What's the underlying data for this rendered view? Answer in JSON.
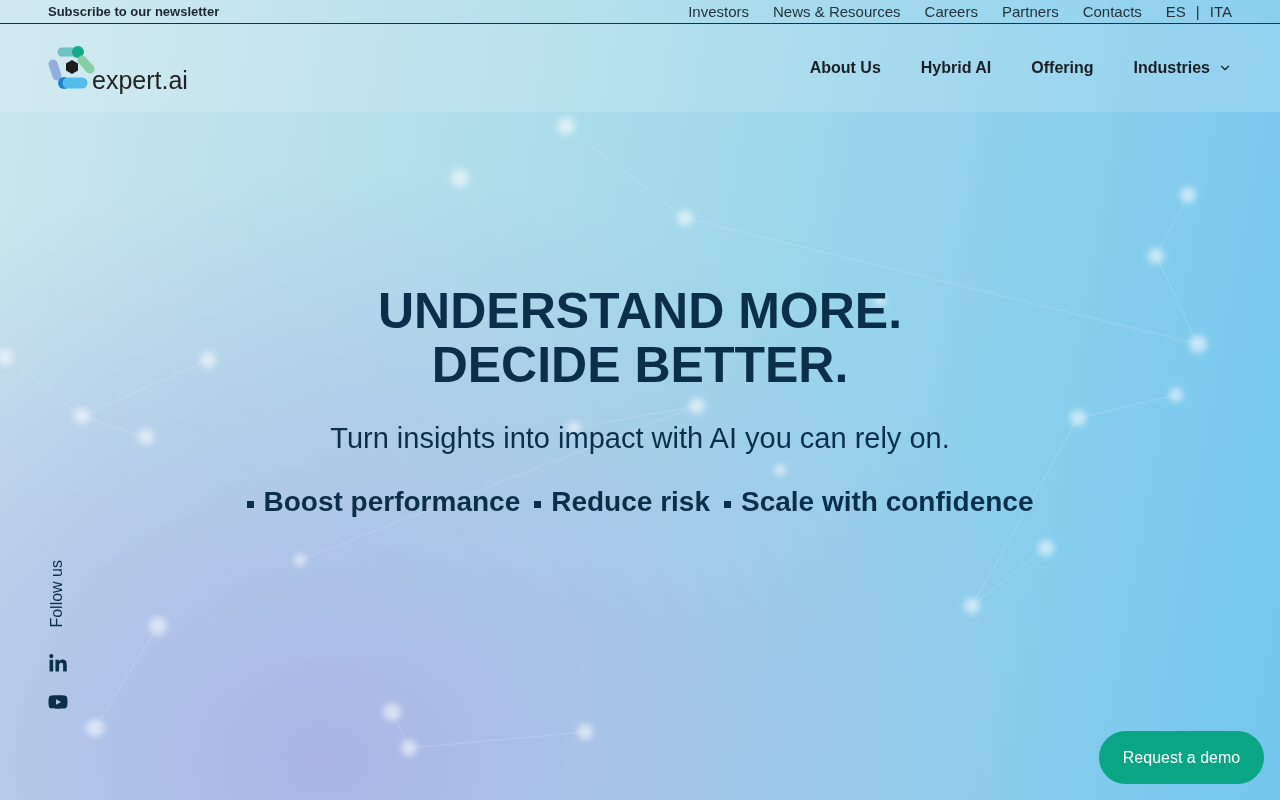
{
  "top_bar": {
    "newsletter_link": "Subscribe to our newsletter",
    "links": [
      "Investors",
      "News & Resources",
      "Careers",
      "Partners",
      "Contacts"
    ],
    "languages": [
      "ES",
      "ITA"
    ],
    "language_separator": "|"
  },
  "header": {
    "logo_text": "expert.ai",
    "nav": [
      {
        "label": "About Us",
        "kind": "link"
      },
      {
        "label": "Hybrid AI",
        "kind": "link"
      },
      {
        "label": "Offering",
        "kind": "link"
      },
      {
        "label": "Industries",
        "kind": "dropdown"
      }
    ]
  },
  "hero": {
    "title_lines": [
      "UNDERSTAND MORE.",
      "DECIDE BETTER."
    ],
    "subtitle": "Turn insights into impact with AI you can rely on.",
    "highlights": [
      "Boost performance",
      "Reduce risk",
      "Scale with confidence"
    ]
  },
  "social": {
    "label": "Follow us",
    "links": [
      {
        "kind": "linkedin"
      },
      {
        "kind": "youtube"
      }
    ]
  },
  "cta": {
    "label": "Request a demo"
  }
}
